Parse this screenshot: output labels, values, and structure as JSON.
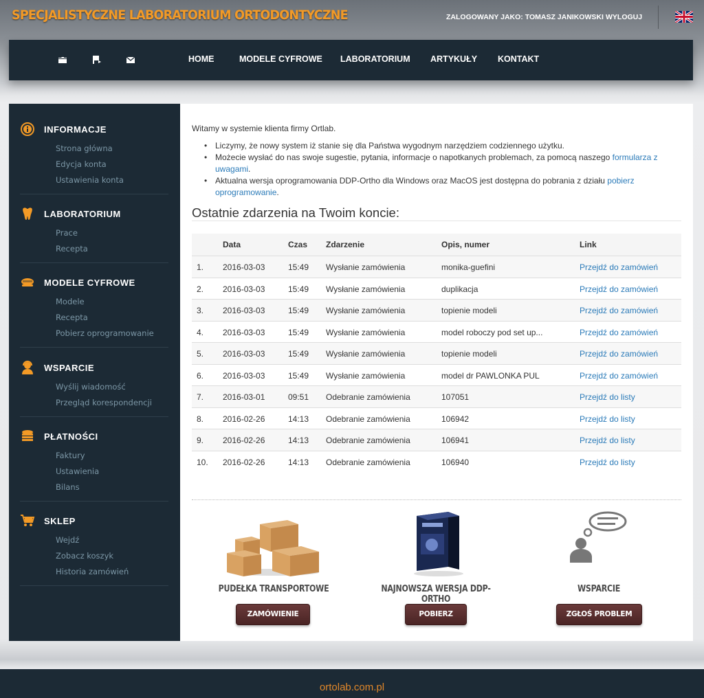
{
  "header": {
    "brand": "SPECJALISTYCZNE LABORATORIUM ORTODONTYCZNE",
    "user_info": "ZALOGOWANY JAKO: TOMASZ JANIKOWSKI",
    "logout": "WYLOGUJ",
    "flag_icon": "uk-flag-icon"
  },
  "nav": {
    "icons": [
      "folder-icon",
      "flag-arrow-icon",
      "envelope-icon"
    ],
    "links": [
      "HOME",
      "MODELE CYFROWE",
      "LABORATORIUM",
      "ARTYKUŁY",
      "KONTAKT"
    ]
  },
  "sidebar": {
    "sections": [
      {
        "title": "INFORMACJE",
        "icon": "info-icon",
        "items": [
          "Strona główna",
          "Edycja konta",
          "Ustawienia konta"
        ]
      },
      {
        "title": "LABORATORIUM",
        "icon": "tooth-icon",
        "items": [
          "Prace",
          "Recepta"
        ]
      },
      {
        "title": "MODELE CYFROWE",
        "icon": "dental-model-icon",
        "items": [
          "Modele",
          "Recepta",
          "Pobierz oprogramowanie"
        ]
      },
      {
        "title": "WSPARCIE",
        "icon": "support-agent-icon",
        "items": [
          "Wyślij wiadomość",
          "Przegląd korespondencji"
        ]
      },
      {
        "title": "PŁATNOŚCI",
        "icon": "coins-icon",
        "items": [
          "Faktury",
          "Ustawienia",
          "Bilans"
        ]
      },
      {
        "title": "SKLEP",
        "icon": "cart-icon",
        "items": [
          "Wejdź",
          "Zobacz koszyk",
          "Historia zamówień"
        ]
      }
    ]
  },
  "main": {
    "intro": "Witamy w systemie klienta firmy Ortlab.",
    "bullets": [
      {
        "text": "Liczymy, że nowy system iż stanie się dla Państwa wygodnym narzędziem codziennego użytku.",
        "link": ""
      },
      {
        "text": "Możecie wysłać do nas swoje sugestie, pytania, informacje o napotkanych problemach, za pomocą naszego ",
        "link": "formularza z uwagami",
        "after": "."
      },
      {
        "text": "Aktualna wersja oprogramowania DDP-Ortho dla Windows oraz MacOS jest dostępna do pobrania z działu ",
        "link": "pobierz oprogramowanie",
        "after": "."
      }
    ],
    "heading": "Ostatnie zdarzenia na Twoim koncie:",
    "table": {
      "columns": [
        "",
        "Data",
        "Czas",
        "Zdarzenie",
        "Opis, numer",
        "Link"
      ],
      "rows": [
        [
          "1.",
          "2016-03-03",
          "15:49",
          "Wysłanie zamówienia",
          "monika-guefini",
          "Przejdź do zamówień"
        ],
        [
          "2.",
          "2016-03-03",
          "15:49",
          "Wysłanie zamówienia",
          "duplikacja",
          "Przejdź do zamówień"
        ],
        [
          "3.",
          "2016-03-03",
          "15:49",
          "Wysłanie zamówienia",
          "topienie modeli",
          "Przejdź do zamówień"
        ],
        [
          "4.",
          "2016-03-03",
          "15:49",
          "Wysłanie zamówienia",
          "model roboczy pod set up...",
          "Przejdź do zamówień"
        ],
        [
          "5.",
          "2016-03-03",
          "15:49",
          "Wysłanie zamówienia",
          "topienie modeli",
          "Przejdź do zamówień"
        ],
        [
          "6.",
          "2016-03-03",
          "15:49",
          "Wysłanie zamówienia",
          "model dr PAWLONKA PUL",
          "Przejdź do zamówień"
        ],
        [
          "7.",
          "2016-03-01",
          "09:51",
          "Odebranie zamówienia",
          "107051",
          "Przejdź do listy"
        ],
        [
          "8.",
          "2016-02-26",
          "14:13",
          "Odebranie zamówienia",
          "106942",
          "Przejdź do listy"
        ],
        [
          "9.",
          "2016-02-26",
          "14:13",
          "Odebranie zamówienia",
          "106941",
          "Przejdź do listy"
        ],
        [
          "10.",
          "2016-02-26",
          "14:13",
          "Odebranie zamówienia",
          "106940",
          "Przejdź do listy"
        ]
      ]
    },
    "promos": [
      {
        "title": "PUDEŁKA TRANSPORTOWE",
        "button": "ZAMÓWIENIE",
        "icon": "boxes-icon"
      },
      {
        "title": "NAJNOWSZA WERSJA DDP-ORTHO",
        "button": "POBIERZ",
        "icon": "software-box-icon"
      },
      {
        "title": "WSPARCIE",
        "button": "ZGŁOŚ PROBLEM",
        "icon": "chat-support-icon"
      }
    ]
  },
  "footer": {
    "text": "ortolab.com.pl"
  },
  "colors": {
    "brand": "#f39a26",
    "nav_bg": "#1c2a35",
    "link": "#2a7ab8",
    "button": "#5a2e2e"
  }
}
